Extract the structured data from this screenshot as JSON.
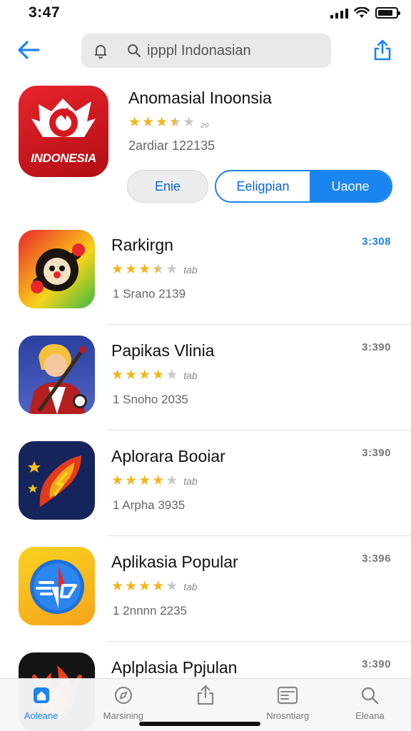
{
  "status_bar": {
    "time": "3:47",
    "battery_level": 0.85
  },
  "nav": {
    "search_value": "ipppl Indonasian",
    "back_icon": "back-arrow-icon",
    "share_icon": "share-icon"
  },
  "featured": {
    "title": "Anomasial Inoonsia",
    "icon_text": "INDONESIA",
    "rating": 3.5,
    "rating_count": "₂₀",
    "meta": "2ardiar 122135",
    "button_left": "Enie",
    "segment_a": "Eeligpian",
    "segment_b": "Uaone"
  },
  "apps": [
    {
      "name": "Rarkirgn",
      "rating": 3.5,
      "rating_count": "tab",
      "meta": "1 Srano 2139",
      "action": "3:308",
      "action_color": "blue",
      "icon": "clown-mascot-icon"
    },
    {
      "name": "Papikas Vlinia",
      "rating": 4,
      "rating_count": "tab",
      "meta": "1 Snoho 2035",
      "action": "3:390",
      "action_color": "gray",
      "icon": "musician-icon"
    },
    {
      "name": "Aplorara Booiar",
      "rating": 4,
      "rating_count": "tab",
      "meta": "1 Arpha 3935",
      "action": "3:390",
      "action_color": "gray",
      "icon": "blaze-star-icon"
    },
    {
      "name": "Aplikasia Popular",
      "rating": 4,
      "rating_count": "tab",
      "meta": "1 2nnnn 2235",
      "action": "3:396",
      "action_color": "gray",
      "icon": "compass-flag-icon"
    },
    {
      "name": "Aplplasia Ppjulan",
      "rating": 0,
      "rating_count": "",
      "meta": "",
      "action": "3:390",
      "action_color": "gray",
      "icon": "flame-icon"
    }
  ],
  "tabs": [
    {
      "label": "Aoleane",
      "icon": "home-icon",
      "active": true
    },
    {
      "label": "Marsining",
      "icon": "compass-icon",
      "active": false
    },
    {
      "label": "",
      "icon": "share-icon",
      "active": false
    },
    {
      "label": "Nrosntiarg",
      "icon": "news-icon",
      "active": false
    },
    {
      "label": "Eleana",
      "icon": "search-icon",
      "active": false
    }
  ],
  "colors": {
    "accent": "#1a84f0",
    "star": "#f2b51c",
    "brand_red": "#d51a22"
  }
}
